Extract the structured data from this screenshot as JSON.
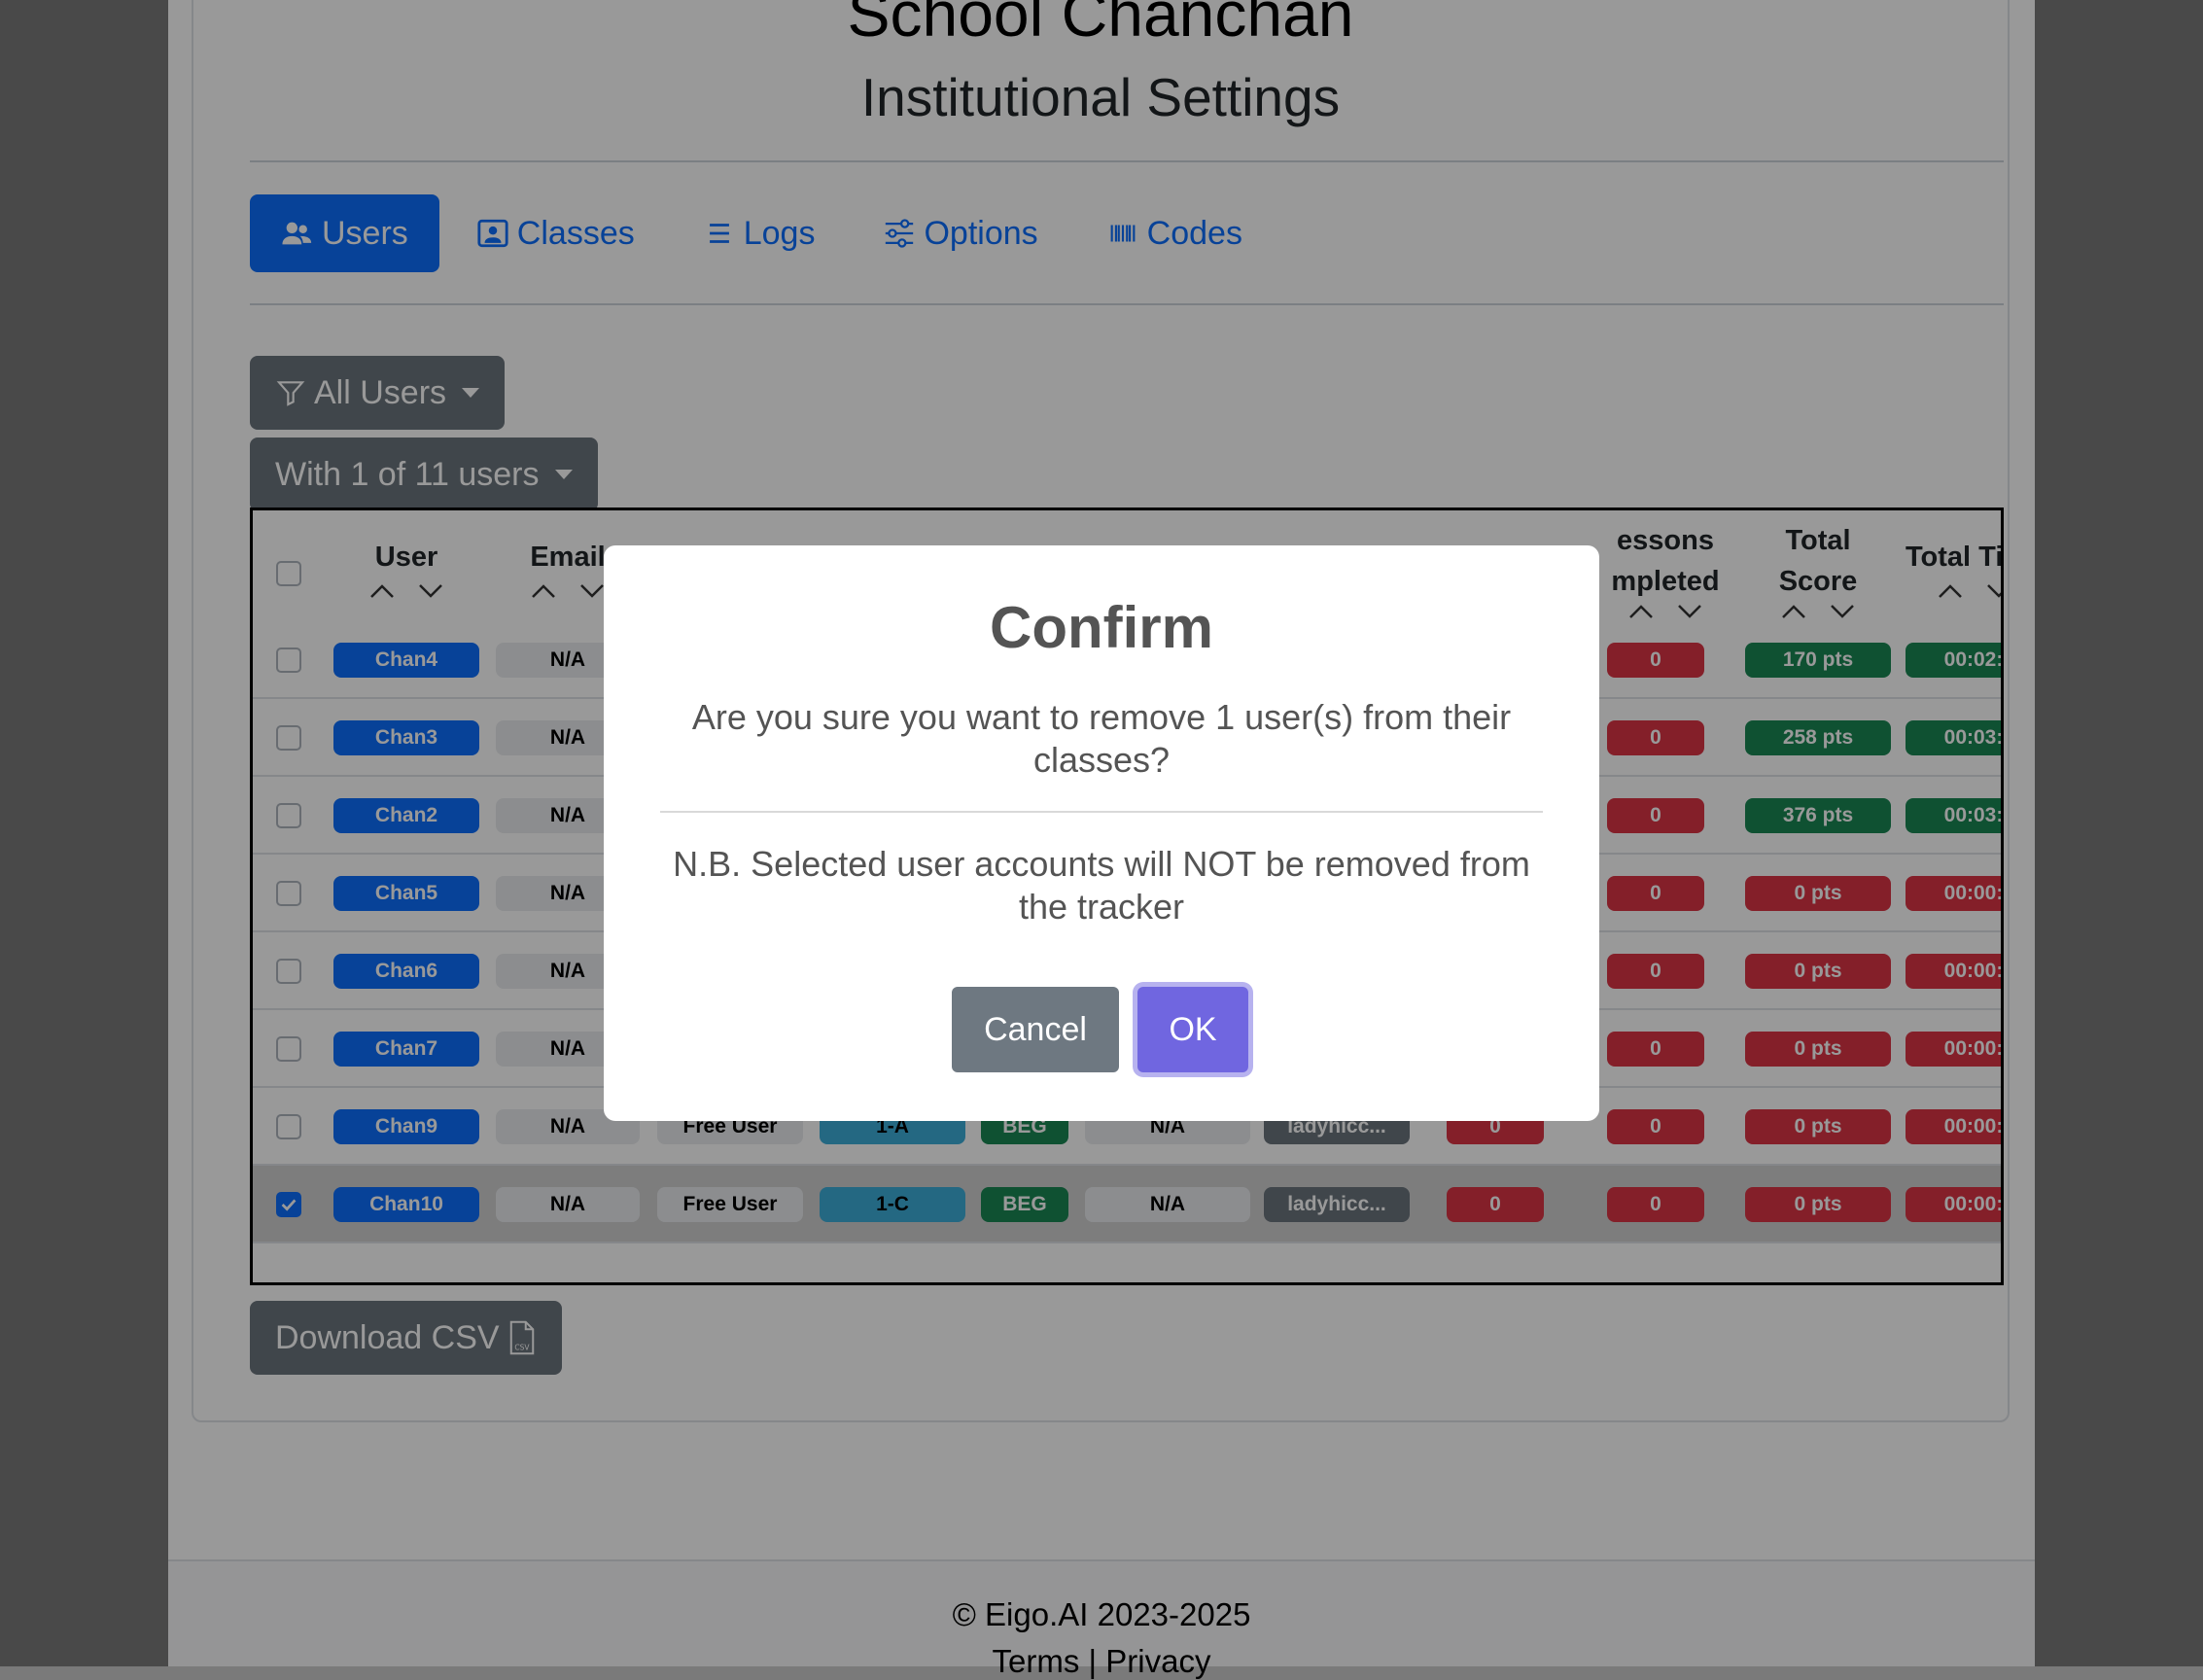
{
  "header": {
    "school_name": "School Chanchan",
    "page_title": "Institutional Settings"
  },
  "tabs": [
    {
      "label": "Users",
      "icon": "users-icon",
      "active": true
    },
    {
      "label": "Classes",
      "icon": "classes-icon",
      "active": false
    },
    {
      "label": "Logs",
      "icon": "list-icon",
      "active": false
    },
    {
      "label": "Options",
      "icon": "sliders-icon",
      "active": false
    },
    {
      "label": "Codes",
      "icon": "barcode-icon",
      "active": false
    }
  ],
  "filters": {
    "user_filter": "All Users",
    "selection": "With 1 of 11 users"
  },
  "table": {
    "columns": {
      "user": "User",
      "email": "Email",
      "lessons_line1": "essons",
      "lessons_line2": "mpleted",
      "score_line1": "Total",
      "score_line2": "Score",
      "time": "Total Ti"
    },
    "rows": [
      {
        "user": "Chan4",
        "email": "N/A",
        "type": "",
        "class": "",
        "level": "",
        "na2": "",
        "teacher": "",
        "c1": "",
        "c2": "0",
        "score": "170 pts",
        "time": "00:02:",
        "score_color": "green",
        "checked": false
      },
      {
        "user": "Chan3",
        "email": "N/A",
        "type": "",
        "class": "",
        "level": "",
        "na2": "",
        "teacher": "",
        "c1": "",
        "c2": "0",
        "score": "258 pts",
        "time": "00:03:",
        "score_color": "green",
        "checked": false
      },
      {
        "user": "Chan2",
        "email": "N/A",
        "type": "",
        "class": "",
        "level": "",
        "na2": "",
        "teacher": "",
        "c1": "",
        "c2": "0",
        "score": "376 pts",
        "time": "00:03:",
        "score_color": "green",
        "checked": false
      },
      {
        "user": "Chan5",
        "email": "N/A",
        "type": "",
        "class": "",
        "level": "",
        "na2": "",
        "teacher": "",
        "c1": "",
        "c2": "0",
        "score": "0 pts",
        "time": "00:00:",
        "score_color": "red",
        "checked": false
      },
      {
        "user": "Chan6",
        "email": "N/A",
        "type": "",
        "class": "",
        "level": "",
        "na2": "",
        "teacher": "",
        "c1": "",
        "c2": "0",
        "score": "0 pts",
        "time": "00:00:",
        "score_color": "red",
        "checked": false
      },
      {
        "user": "Chan7",
        "email": "N/A",
        "type": "",
        "class": "",
        "level": "",
        "na2": "",
        "teacher": "",
        "c1": "",
        "c2": "0",
        "score": "0 pts",
        "time": "00:00:",
        "score_color": "red",
        "checked": false
      },
      {
        "user": "Chan9",
        "email": "N/A",
        "type": "Free User",
        "class": "1-A",
        "level": "BEG",
        "na2": "N/A",
        "teacher": "ladyhicc...",
        "c1": "0",
        "c2": "0",
        "score": "0 pts",
        "time": "00:00:",
        "score_color": "red",
        "checked": false
      },
      {
        "user": "Chan10",
        "email": "N/A",
        "type": "Free User",
        "class": "1-C",
        "level": "BEG",
        "na2": "N/A",
        "teacher": "ladyhicc...",
        "c1": "0",
        "c2": "0",
        "score": "0 pts",
        "time": "00:00:",
        "score_color": "red",
        "checked": true
      }
    ]
  },
  "download_csv": "Download CSV",
  "footer": {
    "copyright": "© Eigo.AI 2023-2025",
    "links": "Terms | Privacy"
  },
  "modal": {
    "title": "Confirm",
    "message": "Are you sure you want to remove 1 user(s) from their classes?",
    "note": "N.B. Selected user accounts will NOT be removed from the tracker",
    "cancel_label": "Cancel",
    "ok_label": "OK"
  },
  "colors": {
    "primary": "#0d6efd",
    "secondary": "#6c757d",
    "success": "#198754",
    "danger": "#dc3545",
    "ok_button": "#7066e0"
  }
}
